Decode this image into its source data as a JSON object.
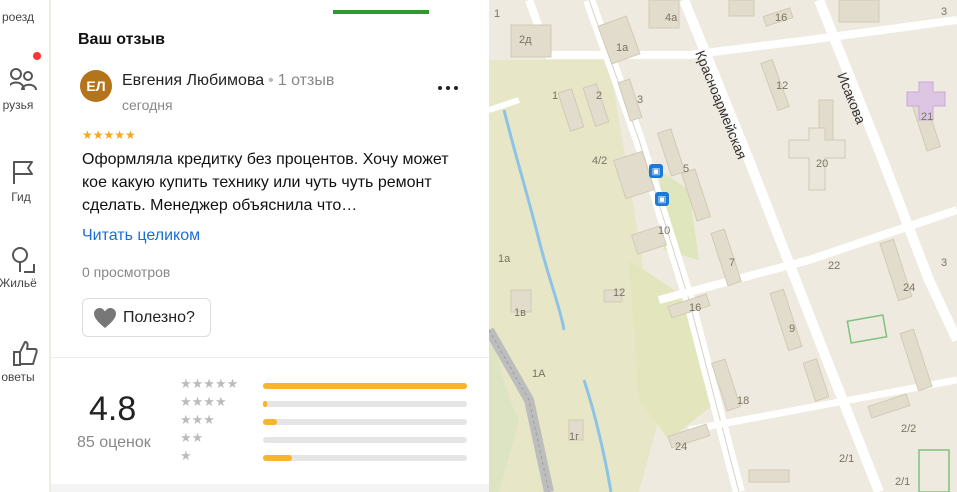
{
  "rail": {
    "items": [
      {
        "label": "роезд",
        "icon": "route-icon"
      },
      {
        "label": "рузья",
        "icon": "friends-icon"
      },
      {
        "label": "Гид",
        "icon": "flag-icon"
      },
      {
        "label": "Жильё",
        "icon": "housing-icon"
      },
      {
        "label": "оветы",
        "icon": "thumbs-up-icon"
      }
    ],
    "notification_color": "#ff3333"
  },
  "panel": {
    "section_title": "Ваш отзыв",
    "accent_color": "#2c9a2c"
  },
  "review": {
    "avatar_initials": "ЕЛ",
    "avatar_color": "#b4741b",
    "author_name": "Евгения Любимова",
    "separator": "•",
    "review_count": "1 отзыв",
    "date": "сегодня",
    "stars": "★★★★★",
    "rating": 5,
    "text": "Оформляла кредитку без процентов. Хочу может кое какую купить технику или чуть чуть ремонт сделать. Менеджер объяснила что…",
    "read_more": "Читать целиком",
    "views": "0 просмотров",
    "useful_label": "Полезно?"
  },
  "rating_summary": {
    "value": "4.8",
    "count_label": "85 оценок",
    "distribution": [
      {
        "stars": 5,
        "stars_text": "★★★★★",
        "fraction": 1.0
      },
      {
        "stars": 4,
        "stars_text": "★★★★",
        "fraction": 0.02
      },
      {
        "stars": 3,
        "stars_text": "★★★",
        "fraction": 0.07
      },
      {
        "stars": 2,
        "stars_text": "★★",
        "fraction": 0.0
      },
      {
        "stars": 1,
        "stars_text": "★",
        "fraction": 0.14
      }
    ],
    "bar_color": "#f8b42a"
  },
  "map": {
    "streets": [
      "Красноармейская",
      "Исакова"
    ],
    "house_numbers": [
      "2д",
      "1а",
      "4а",
      "16",
      "1",
      "2",
      "3",
      "12",
      "1",
      "4/2",
      "5",
      "20",
      "10",
      "7",
      "22",
      "1а",
      "12",
      "1в",
      "16",
      "24",
      "1А",
      "9",
      "18",
      "1г",
      "2/2",
      "24",
      "2/1",
      "2/1",
      "21",
      "3",
      "3"
    ]
  }
}
